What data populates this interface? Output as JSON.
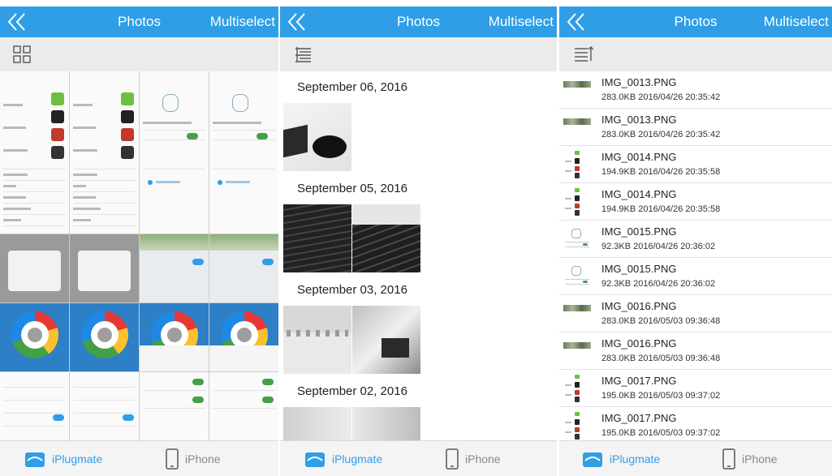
{
  "panels": [
    {
      "navbar": {
        "title": "Photos",
        "multiselect": "Multiselect"
      },
      "tabs": [
        {
          "label": "iPlugmate"
        },
        {
          "label": "iPhone"
        }
      ]
    },
    {
      "navbar": {
        "title": "Photos",
        "multiselect": "Multiselect"
      },
      "tabs": [
        {
          "label": "iPlugmate"
        },
        {
          "label": "iPhone"
        }
      ],
      "date_groups": [
        {
          "date": "September 06, 2016"
        },
        {
          "date": "September 05, 2016"
        },
        {
          "date": "September 03, 2016"
        },
        {
          "date": "September 02, 2016"
        }
      ]
    },
    {
      "navbar": {
        "title": "Photos",
        "multiselect": "Multiselect"
      },
      "tabs": [
        {
          "label": "iPlugmate"
        },
        {
          "label": "iPhone"
        }
      ],
      "files": [
        {
          "name": "IMG_0013.PNG",
          "meta": "283.0KB  2016/04/26 20:35:42",
          "thumb": "strip"
        },
        {
          "name": "IMG_0013.PNG",
          "meta": "283.0KB  2016/04/26 20:35:42",
          "thumb": "strip"
        },
        {
          "name": "IMG_0014.PNG",
          "meta": "194.9KB  2016/04/26 20:35:58",
          "thumb": "devices"
        },
        {
          "name": "IMG_0014.PNG",
          "meta": "194.9KB  2016/04/26 20:35:58",
          "thumb": "devices"
        },
        {
          "name": "IMG_0015.PNG",
          "meta": "92.3KB  2016/04/26 20:36:02",
          "thumb": "diagram"
        },
        {
          "name": "IMG_0015.PNG",
          "meta": "92.3KB  2016/04/26 20:36:02",
          "thumb": "diagram"
        },
        {
          "name": "IMG_0016.PNG",
          "meta": "283.0KB  2016/05/03 09:36:48",
          "thumb": "strip"
        },
        {
          "name": "IMG_0016.PNG",
          "meta": "283.0KB  2016/05/03 09:36:48",
          "thumb": "strip"
        },
        {
          "name": "IMG_0017.PNG",
          "meta": "195.0KB  2016/05/03 09:37:02",
          "thumb": "devices"
        },
        {
          "name": "IMG_0017.PNG",
          "meta": "195.0KB  2016/05/03 09:37:02",
          "thumb": "devices"
        }
      ]
    }
  ],
  "colors": {
    "accent": "#2f9ee6",
    "toolbar": "#ebebeb",
    "tabbar": "#f4f4f4"
  },
  "icons": {
    "back": "double-chevron-left-icon",
    "grid": "grid-view-icon",
    "timeline": "timeline-view-icon",
    "list": "list-view-icon",
    "iplugmate": "iplugmate-device-icon",
    "iphone": "iphone-icon"
  }
}
